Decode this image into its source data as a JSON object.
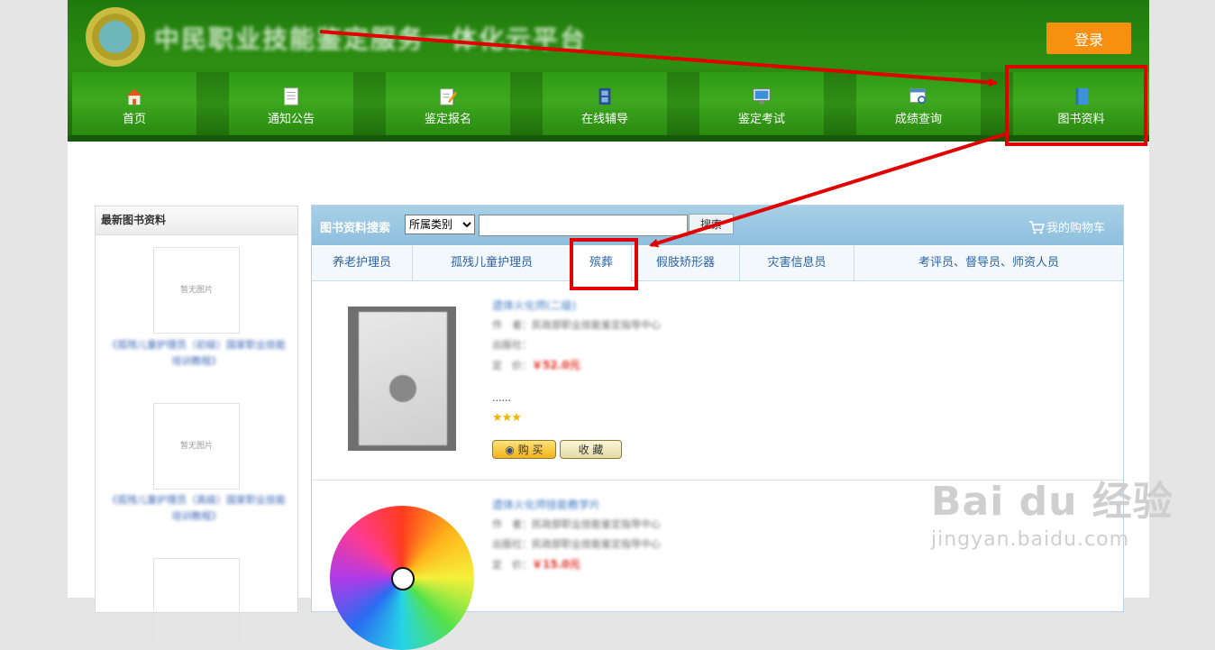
{
  "header": {
    "site_title": "中民职业技能鉴定服务一体化云平台",
    "login_label": "登录"
  },
  "nav": {
    "items": [
      {
        "label": "首页",
        "icon": "home-icon"
      },
      {
        "label": "通知公告",
        "icon": "document-icon"
      },
      {
        "label": "鉴定报名",
        "icon": "edit-form-icon"
      },
      {
        "label": "在线辅导",
        "icon": "film-icon"
      },
      {
        "label": "鉴定考试",
        "icon": "monitor-icon"
      },
      {
        "label": "成绩查询",
        "icon": "search-report-icon"
      },
      {
        "label": "图书资料",
        "icon": "book-icon"
      }
    ]
  },
  "sidebar": {
    "title": "最新图书资料",
    "no_image": "暂无图片",
    "books": [
      {
        "caption": "《孤残儿童护理员（初级）国家职业技能培训教程》"
      },
      {
        "caption": "《孤残儿童护理员（高级）国家职业技能培训教程》"
      }
    ]
  },
  "search": {
    "title": "图书资料搜索",
    "category_selected": "所属类别",
    "input_value": "",
    "button_label": "搜索",
    "cart_label": "我的购物车"
  },
  "tabs": [
    {
      "label": "养老护理员"
    },
    {
      "label": "孤残儿童护理员"
    },
    {
      "label": "殡葬"
    },
    {
      "label": "假肢矫形器"
    },
    {
      "label": "灾害信息员"
    },
    {
      "label": "考评员、督导员、师资人员"
    }
  ],
  "active_tab": "殡葬",
  "products": [
    {
      "title": "遗体火化师(二级)",
      "author_label": "作　者：",
      "author": "民政部职业技能鉴定指导中心",
      "publisher_label": "出版社：",
      "publisher": "",
      "price_label": "定　价：",
      "price": "￥52.0元",
      "summary": "......",
      "rating": 3,
      "buy_label": "购 买",
      "fav_label": "收 藏"
    },
    {
      "title": "遗体火化师技能教学片",
      "author_label": "作　者：",
      "author": "民政部职业技能鉴定指导中心",
      "publisher_label": "出版社：",
      "publisher": "民政部职业技能鉴定指导中心",
      "price_label": "定　价：",
      "price": "￥15.0元"
    }
  ],
  "watermark": {
    "brand": "Bai du 经验",
    "url": "jingyan.baidu.com"
  },
  "colors": {
    "header_green": "#2d8f12",
    "login_orange": "#f7900f",
    "annotation_red": "#e00000",
    "search_bar_blue": "#a8d0e8"
  }
}
